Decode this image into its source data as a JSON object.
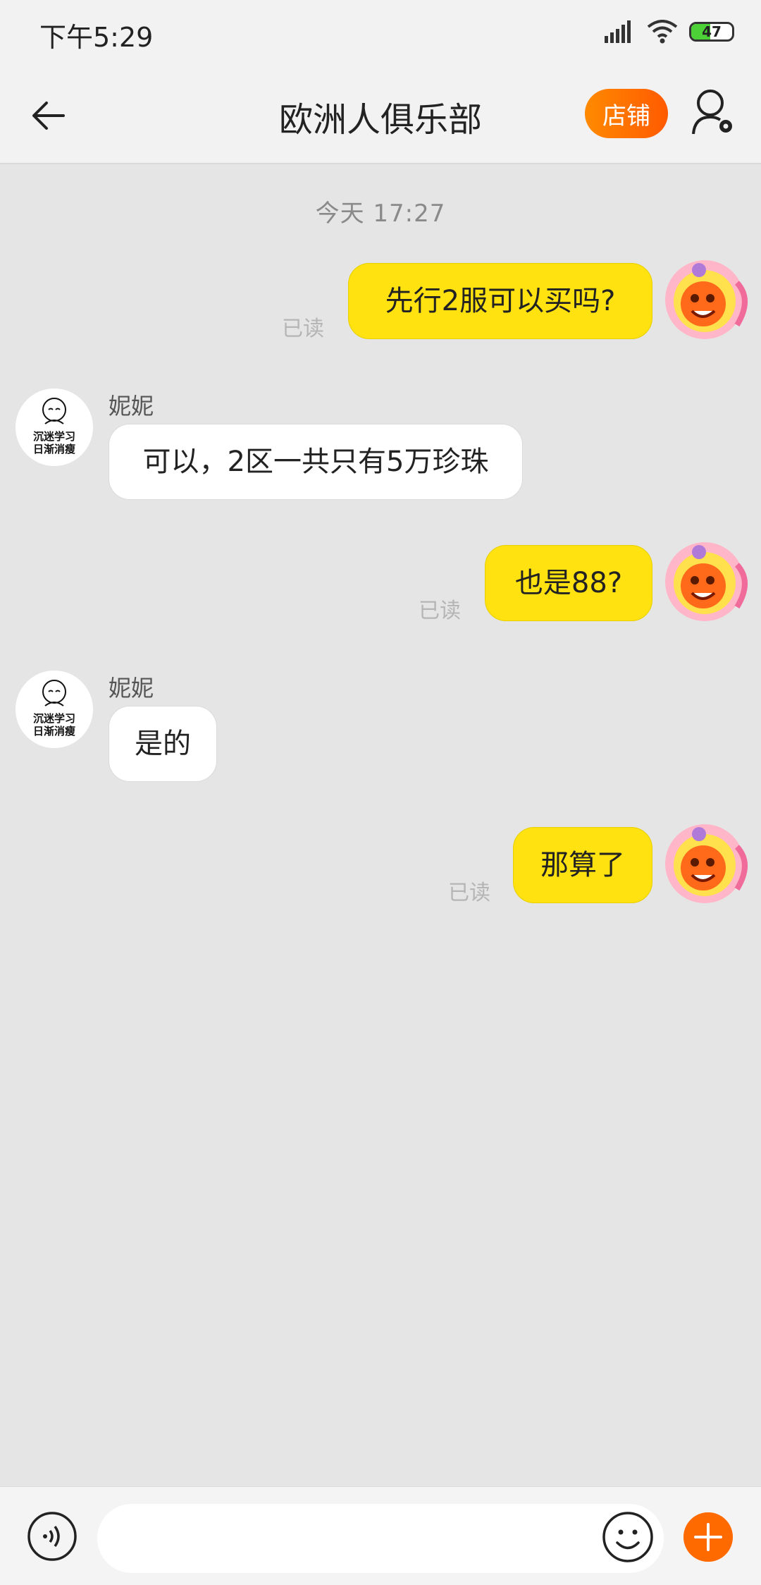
{
  "status_bar": {
    "time": "下午5:29",
    "battery_level": "47",
    "battery_fraction": 0.47,
    "icons": [
      "signal-icon",
      "wifi-icon",
      "battery-icon"
    ]
  },
  "header": {
    "title": "欧洲人俱乐部",
    "shop_label": "店铺",
    "icons": [
      "back-arrow-icon",
      "user-settings-icon"
    ]
  },
  "chat": {
    "timestamp": "今天  17:27",
    "messages": [
      {
        "from": "me",
        "text": "先行2服可以买吗?",
        "status": "已读"
      },
      {
        "from": "other",
        "sender": "妮妮",
        "text": "可以，2区一共只有5万珍珠"
      },
      {
        "from": "me",
        "text": "也是88?",
        "status": "已读"
      },
      {
        "from": "other",
        "sender": "妮妮",
        "text": "是的"
      },
      {
        "from": "me",
        "text": "那算了",
        "status": "已读"
      }
    ],
    "other_avatar_caption": [
      "沉迷学习",
      "日渐消瘦"
    ]
  },
  "input_bar": {
    "placeholder": "",
    "icons": [
      "voice-icon",
      "emoji-icon",
      "plus-icon"
    ]
  },
  "colors": {
    "my_bubble": "#ffe20f",
    "accent_orange": "#ff6a00",
    "background": "#e5e5e5"
  }
}
